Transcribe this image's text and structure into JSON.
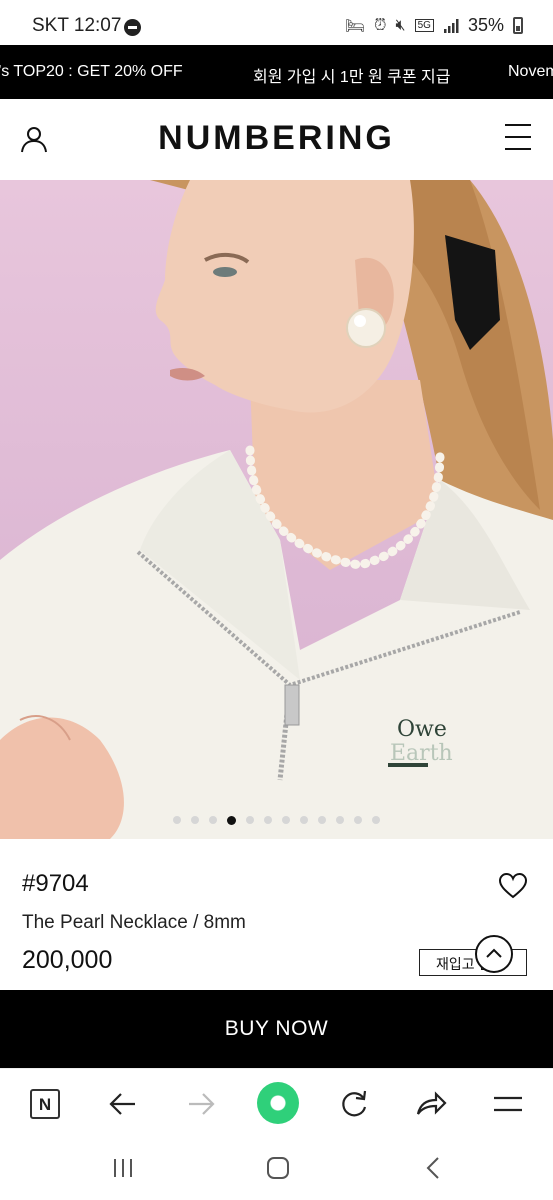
{
  "status_bar": {
    "carrier": "SKT",
    "time": "12:07",
    "network": "5G",
    "battery": "35%"
  },
  "promo_bar": {
    "left_text": "’s TOP20 : GET 20% OFF",
    "center_text": "회원 가입 시 1만 원 쿠폰 지급",
    "right_text": "Novem"
  },
  "header": {
    "logo": "NUMBERING",
    "user_icon": "user-icon",
    "menu_icon": "hamburger-menu-icon"
  },
  "hero": {
    "sweatshirt_print_line1": "Owe",
    "sweatshirt_print_line2": "Earth",
    "slide_count": 12,
    "active_slide": 4
  },
  "product": {
    "id": "#9704",
    "name": "The Pearl Necklace / 8mm",
    "price": "200,000",
    "restock_label": "재입고 알림",
    "wishlist_icon": "heart-icon",
    "scroll_top_icon": "chevron-up-icon"
  },
  "buy_now": {
    "label": "BUY NOW"
  },
  "browser_toolbar": {
    "home_letter": "N",
    "icons": [
      "browser-home-icon",
      "back-arrow-icon",
      "forward-arrow-icon",
      "tab-switch-icon",
      "refresh-icon",
      "share-icon",
      "menu-icon"
    ]
  },
  "system_nav": {
    "icons": [
      "recent-apps-icon",
      "home-icon",
      "back-icon"
    ]
  },
  "colors": {
    "promo_background": "#000000",
    "hero_background": "#e2bfd9",
    "accent_green": "#2fd07a"
  }
}
